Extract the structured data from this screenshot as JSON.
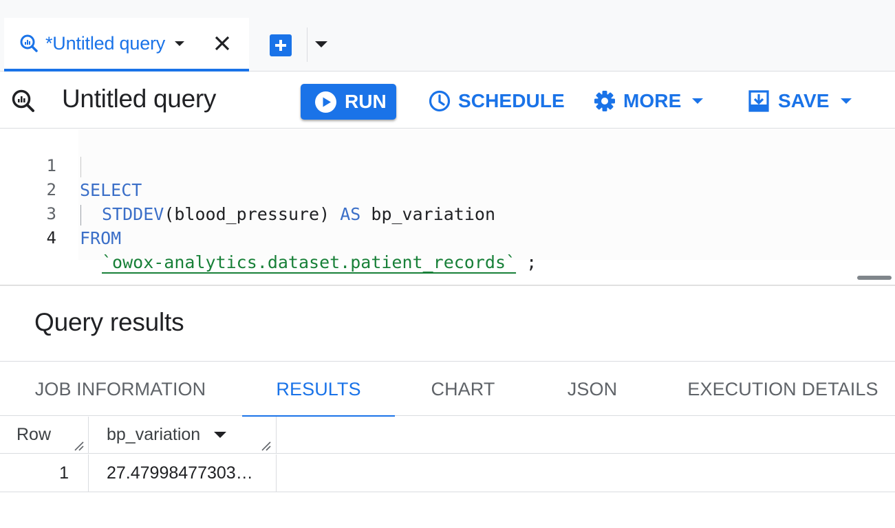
{
  "tab": {
    "label": "*Untitled query"
  },
  "toolbar": {
    "title": "Untitled query",
    "run_label": "RUN",
    "schedule_label": "SCHEDULE",
    "more_label": "MORE",
    "save_label": "SAVE"
  },
  "editor": {
    "line_numbers": [
      "1",
      "2",
      "3",
      "4"
    ],
    "line1": "SELECT",
    "line2_fn": "STDDEV",
    "line2_open": "(",
    "line2_arg": "blood_pressure",
    "line2_close": ")",
    "line2_as": "AS",
    "line2_alias": "bp_variation",
    "line3": "FROM",
    "line4_table": "`owox-analytics.dataset.patient_records`",
    "line4_end": ";"
  },
  "results": {
    "title": "Query results",
    "tabs": [
      "JOB INFORMATION",
      "RESULTS",
      "CHART",
      "JSON",
      "EXECUTION DETAILS"
    ],
    "active_tab": "RESULTS",
    "columns": [
      "Row",
      "bp_variation"
    ],
    "rows": [
      {
        "row": "1",
        "bp_variation": "27.47998477303…"
      }
    ]
  },
  "colors": {
    "accent": "#1a73e8",
    "keyword": "#3b6fc8",
    "string": "#188038"
  },
  "icons": [
    "query-icon",
    "close-icon",
    "add-tab-icon",
    "play-icon",
    "clock-icon",
    "gear-icon",
    "save-icon"
  ]
}
